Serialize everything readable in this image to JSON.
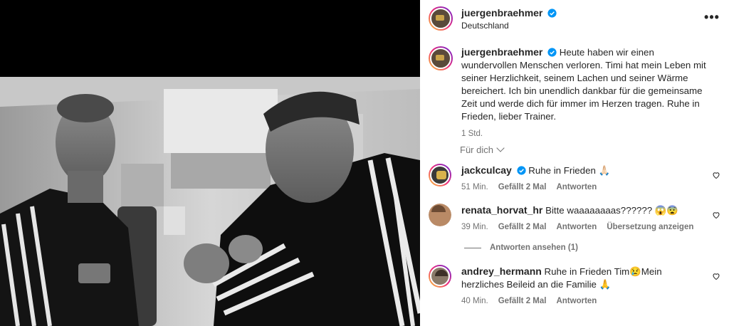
{
  "post": {
    "author": "juergenbraehmer",
    "location": "Deutschland",
    "more_icon": "more-horizontal-icon",
    "caption": "Heute haben wir einen wundervollen Menschen verloren. Timi hat mein Leben mit seiner Herzlichkeit, seinem Lachen und seiner Wärme bereichert. Ich bin unendlich dankbar für die gemeinsame Zeit und werde dich für immer im Herzen tragen. Ruhe in Frieden, lieber Trainer.",
    "time": "1 Std."
  },
  "sort_label": "Für dich",
  "colors": {
    "verified": "#0095f6",
    "muted": "#737373",
    "text": "#262626"
  },
  "comments": [
    {
      "user": "jackculcay",
      "text": "Ruhe in Frieden 🙏🏻",
      "time": "51 Min.",
      "likes": "Gefällt 2 Mal",
      "reply": "Antworten"
    },
    {
      "user": "renata_horvat_hr",
      "text": "Bitte waaaaaaaas?????? 😱😨",
      "time": "39 Min.",
      "likes": "Gefällt 2 Mal",
      "reply": "Antworten",
      "translate": "Übersetzung anzeigen"
    },
    {
      "user": "andrey_hermann",
      "text": "Ruhe in Frieden Tim😢Mein herzliches Beileid an die Familie 🙏",
      "time": "40 Min.",
      "likes": "Gefällt 2 Mal",
      "reply": "Antworten"
    }
  ],
  "view_replies": "Antworten ansehen (1)"
}
